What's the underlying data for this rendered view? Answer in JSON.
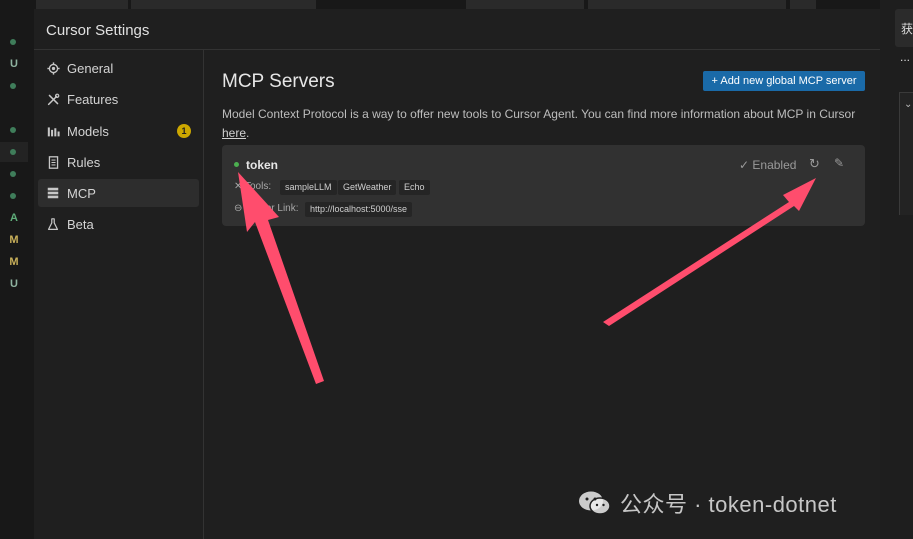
{
  "window": {
    "title": "Cursor Settings"
  },
  "activity_bar": {
    "letters": [
      "U",
      "A",
      "M",
      "M",
      "U"
    ]
  },
  "sidebar": {
    "items": [
      {
        "label": "General",
        "icon": "gear-icon"
      },
      {
        "label": "Features",
        "icon": "tools-icon"
      },
      {
        "label": "Models",
        "icon": "chart-icon",
        "badge": "1"
      },
      {
        "label": "Rules",
        "icon": "document-icon"
      },
      {
        "label": "MCP",
        "icon": "server-icon",
        "active": true
      },
      {
        "label": "Beta",
        "icon": "flask-icon"
      }
    ]
  },
  "main": {
    "heading": "MCP Servers",
    "add_button": "+ Add new global MCP server",
    "description": "Model Context Protocol is a way to offer new tools to Cursor Agent. You can find more information about MCP in Cursor",
    "description_link": "here",
    "description_end": ".",
    "server": {
      "name": "token",
      "status_color": "#4caf50",
      "enabled_label": "Enabled",
      "tools_label": "Tools:",
      "tools": [
        "sampleLLM",
        "GetWeather",
        "Echo"
      ],
      "server_link_label": "Server Link:",
      "server_link": "http://localhost:5000/sse"
    }
  },
  "right_panel": {
    "glyph": "获",
    "ellipsis": "..."
  },
  "watermark": {
    "text": "公众号 · token-dotnet"
  },
  "colors": {
    "accent": "#1a6aa8",
    "arrow": "#ff4d6d",
    "badge": "#cca700"
  }
}
